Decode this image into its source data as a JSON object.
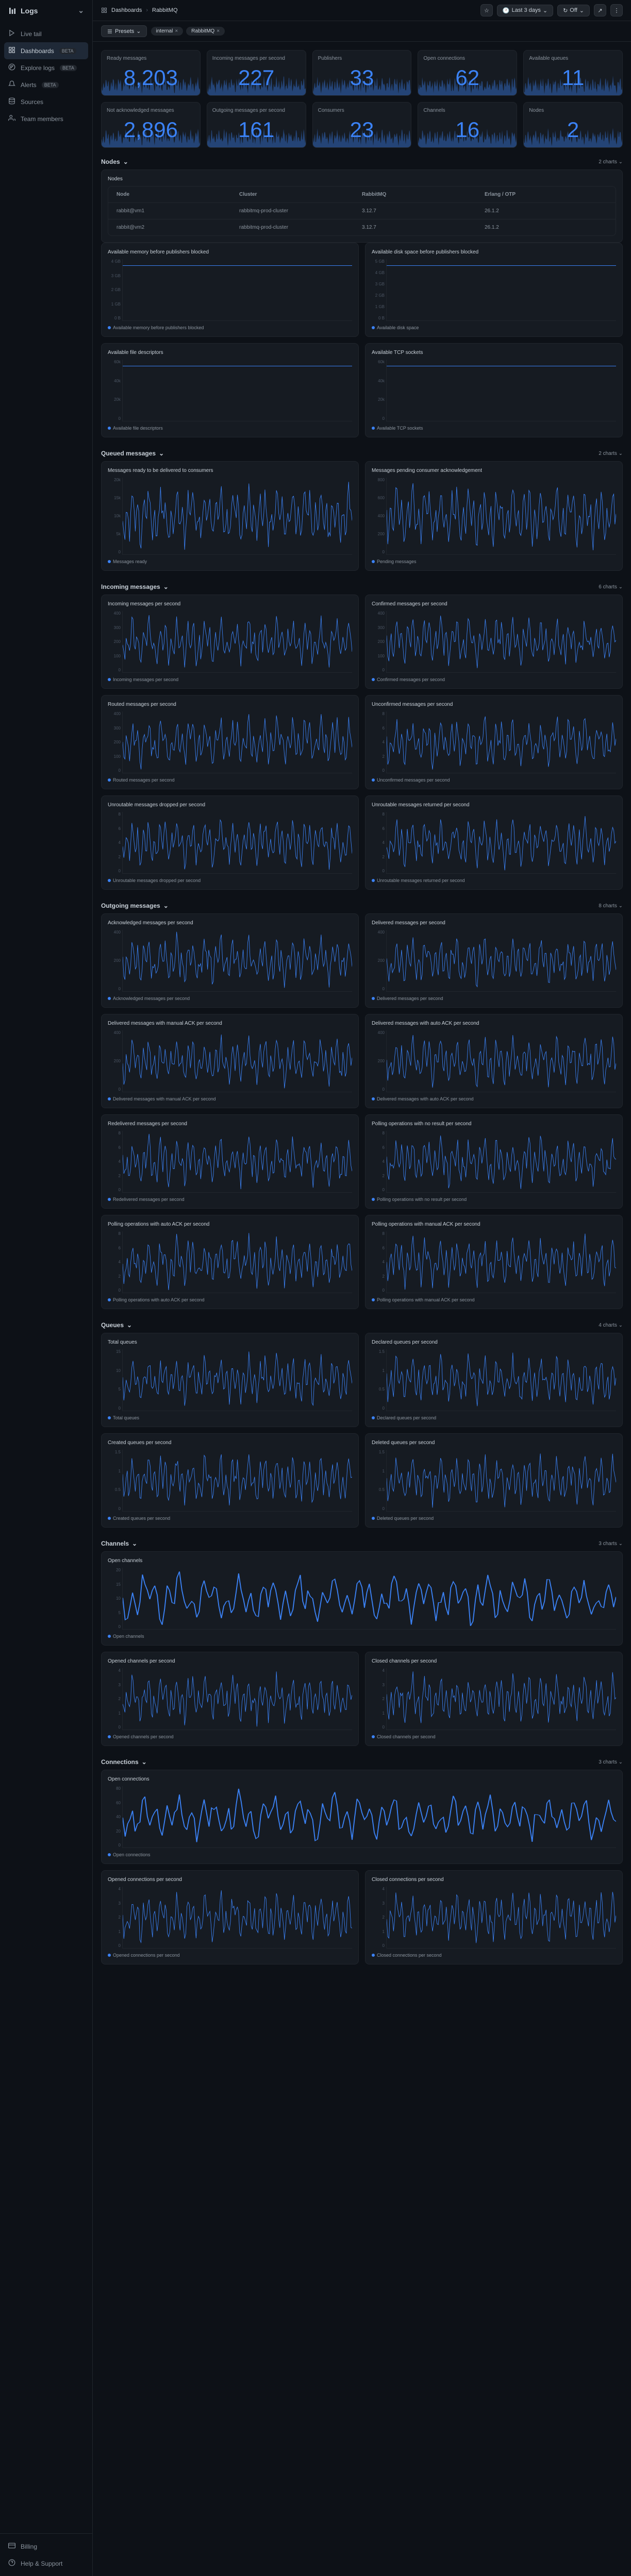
{
  "brand": "Logs",
  "sidebar": {
    "items": [
      {
        "label": "Live tail",
        "icon": "play"
      },
      {
        "label": "Dashboards",
        "icon": "grid",
        "badge": "BETA",
        "active": true
      },
      {
        "label": "Explore logs",
        "icon": "explore",
        "badge": "BETA"
      },
      {
        "label": "Alerts",
        "icon": "bell",
        "badge": "BETA"
      },
      {
        "label": "Sources",
        "icon": "db"
      },
      {
        "label": "Team members",
        "icon": "users"
      }
    ],
    "footer": [
      {
        "label": "Billing",
        "icon": "card"
      },
      {
        "label": "Help & Support",
        "icon": "help"
      }
    ]
  },
  "breadcrumb": {
    "section": "Dashboards",
    "page": "RabbitMQ"
  },
  "topbar": {
    "timerange": "Last 3 days",
    "off": "Off"
  },
  "toolbar": {
    "presets": "Presets",
    "pills": [
      "internal",
      "RabbitMQ"
    ]
  },
  "metrics_row1": [
    {
      "label": "Ready messages",
      "value": "8,203"
    },
    {
      "label": "Incoming messages per second",
      "value": "227"
    },
    {
      "label": "Publishers",
      "value": "33"
    },
    {
      "label": "Open connections",
      "value": "62"
    },
    {
      "label": "Available queues",
      "value": "11"
    }
  ],
  "metrics_row2": [
    {
      "label": "Not acknowledged messages",
      "value": "2,896"
    },
    {
      "label": "Outgoing messages per second",
      "value": "161"
    },
    {
      "label": "Consumers",
      "value": "23"
    },
    {
      "label": "Channels",
      "value": "16"
    },
    {
      "label": "Nodes",
      "value": "2"
    }
  ],
  "nodes": {
    "title": "Nodes",
    "count": "2 charts",
    "table_title": "Nodes",
    "headers": [
      "Node",
      "Cluster",
      "RabbitMQ",
      "Erlang / OTP"
    ],
    "rows": [
      [
        "rabbit@vm1",
        "rabbitmq-prod-cluster",
        "3.12.7",
        "26.1.2"
      ],
      [
        "rabbit@vm2",
        "rabbitmq-prod-cluster",
        "3.12.7",
        "26.1.2"
      ]
    ],
    "charts": [
      {
        "title": "Available memory before publishers blocked",
        "legend": "Available memory before publishers blocked",
        "ylabels": [
          "4 GB",
          "3 GB",
          "2 GB",
          "1 GB",
          "0 B"
        ],
        "type": "flat"
      },
      {
        "title": "Available disk space before publishers blocked",
        "legend": "Available disk space",
        "ylabels": [
          "5 GB",
          "4 GB",
          "3 GB",
          "2 GB",
          "1 GB",
          "0 B"
        ],
        "type": "flat"
      },
      {
        "title": "Available file descriptors",
        "legend": "Available file descriptors",
        "ylabels": [
          "60k",
          "40k",
          "20k",
          "0"
        ],
        "type": "flat"
      },
      {
        "title": "Available TCP sockets",
        "legend": "Available TCP sockets",
        "ylabels": [
          "60k",
          "40k",
          "20k",
          "0"
        ],
        "type": "flat"
      }
    ]
  },
  "sections": [
    {
      "title": "Queued messages",
      "count": "2 charts",
      "charts": [
        {
          "title": "Messages ready to be delivered to consumers",
          "legend": "Messages ready",
          "ylabels": [
            "20k",
            "15k",
            "10k",
            "5k",
            "0"
          ],
          "tall": true
        },
        {
          "title": "Messages pending consumer acknowledgement",
          "legend": "Pending messages",
          "ylabels": [
            "800",
            "600",
            "400",
            "200",
            "0"
          ],
          "tall": true
        }
      ]
    },
    {
      "title": "Incoming messages",
      "count": "6 charts",
      "charts": [
        {
          "title": "Incoming messages per second",
          "legend": "Incoming messages per second",
          "ylabels": [
            "400",
            "300",
            "200",
            "100",
            "0"
          ]
        },
        {
          "title": "Confirmed messages per second",
          "legend": "Confirmed messages per second",
          "ylabels": [
            "400",
            "300",
            "200",
            "100",
            "0"
          ]
        },
        {
          "title": "Routed messages per second",
          "legend": "Routed messages per second",
          "ylabels": [
            "400",
            "300",
            "200",
            "100",
            "0"
          ]
        },
        {
          "title": "Unconfirmed messages per second",
          "legend": "Unconfirmed messages per second",
          "ylabels": [
            "8",
            "6",
            "4",
            "2",
            "0"
          ]
        },
        {
          "title": "Unroutable messages dropped per second",
          "legend": "Unroutable messages dropped per second",
          "ylabels": [
            "8",
            "6",
            "4",
            "2",
            "0"
          ]
        },
        {
          "title": "Unroutable messages returned per second",
          "legend": "Unroutable messages returned per second",
          "ylabels": [
            "8",
            "6",
            "4",
            "2",
            "0"
          ]
        }
      ]
    },
    {
      "title": "Outgoing messages",
      "count": "8 charts",
      "charts": [
        {
          "title": "Acknowledged messages per second",
          "legend": "Acknowledged messages per second",
          "ylabels": [
            "400",
            "200",
            "0"
          ]
        },
        {
          "title": "Delivered messages per second",
          "legend": "Delivered messages per second",
          "ylabels": [
            "400",
            "200",
            "0"
          ]
        },
        {
          "title": "Delivered messages with manual ACK per second",
          "legend": "Delivered messages with manual ACK per second",
          "ylabels": [
            "400",
            "200",
            "0"
          ]
        },
        {
          "title": "Delivered messages with auto ACK per second",
          "legend": "Delivered messages with auto ACK per second",
          "ylabels": [
            "400",
            "200",
            "0"
          ]
        },
        {
          "title": "Redelivered messages per second",
          "legend": "Redelivered messages per second",
          "ylabels": [
            "8",
            "6",
            "4",
            "2",
            "0"
          ]
        },
        {
          "title": "Polling operations with no result per second",
          "legend": "Polling operations with no result per second",
          "ylabels": [
            "8",
            "6",
            "4",
            "2",
            "0"
          ]
        },
        {
          "title": "Polling operations with auto ACK per second",
          "legend": "Polling operations with auto ACK per second",
          "ylabels": [
            "8",
            "6",
            "4",
            "2",
            "0"
          ]
        },
        {
          "title": "Polling operations with manual ACK per second",
          "legend": "Polling operations with manual ACK per second",
          "ylabels": [
            "8",
            "6",
            "4",
            "2",
            "0"
          ]
        }
      ]
    },
    {
      "title": "Queues",
      "count": "4 charts",
      "charts": [
        {
          "title": "Total queues",
          "legend": "Total queues",
          "ylabels": [
            "15",
            "10",
            "5",
            "0"
          ]
        },
        {
          "title": "Declared queues per second",
          "legend": "Declared queues per second",
          "ylabels": [
            "1.5",
            "1",
            "0.5",
            "0"
          ]
        },
        {
          "title": "Created queues per second",
          "legend": "Created queues per second",
          "ylabels": [
            "1.5",
            "1",
            "0.5",
            "0"
          ]
        },
        {
          "title": "Deleted queues per second",
          "legend": "Deleted queues per second",
          "ylabels": [
            "1.5",
            "1",
            "0.5",
            "0"
          ]
        }
      ]
    },
    {
      "title": "Channels",
      "count": "3 charts",
      "charts": [
        {
          "title": "Open channels",
          "legend": "Open channels",
          "ylabels": [
            "20",
            "15",
            "10",
            "5",
            "0"
          ],
          "full": true
        },
        {
          "title": "Opened channels per second",
          "legend": "Opened channels per second",
          "ylabels": [
            "4",
            "3",
            "2",
            "1",
            "0"
          ]
        },
        {
          "title": "Closed channels per second",
          "legend": "Closed channels per second",
          "ylabels": [
            "4",
            "3",
            "2",
            "1",
            "0"
          ]
        }
      ]
    },
    {
      "title": "Connections",
      "count": "3 charts",
      "charts": [
        {
          "title": "Open connections",
          "legend": "Open connections",
          "ylabels": [
            "80",
            "60",
            "40",
            "20",
            "0"
          ],
          "full": true
        },
        {
          "title": "Opened connections per second",
          "legend": "Opened connections per second",
          "ylabels": [
            "4",
            "3",
            "2",
            "1",
            "0"
          ]
        },
        {
          "title": "Closed connections per second",
          "legend": "Closed connections per second",
          "ylabels": [
            "4",
            "3",
            "2",
            "1",
            "0"
          ]
        }
      ]
    }
  ]
}
